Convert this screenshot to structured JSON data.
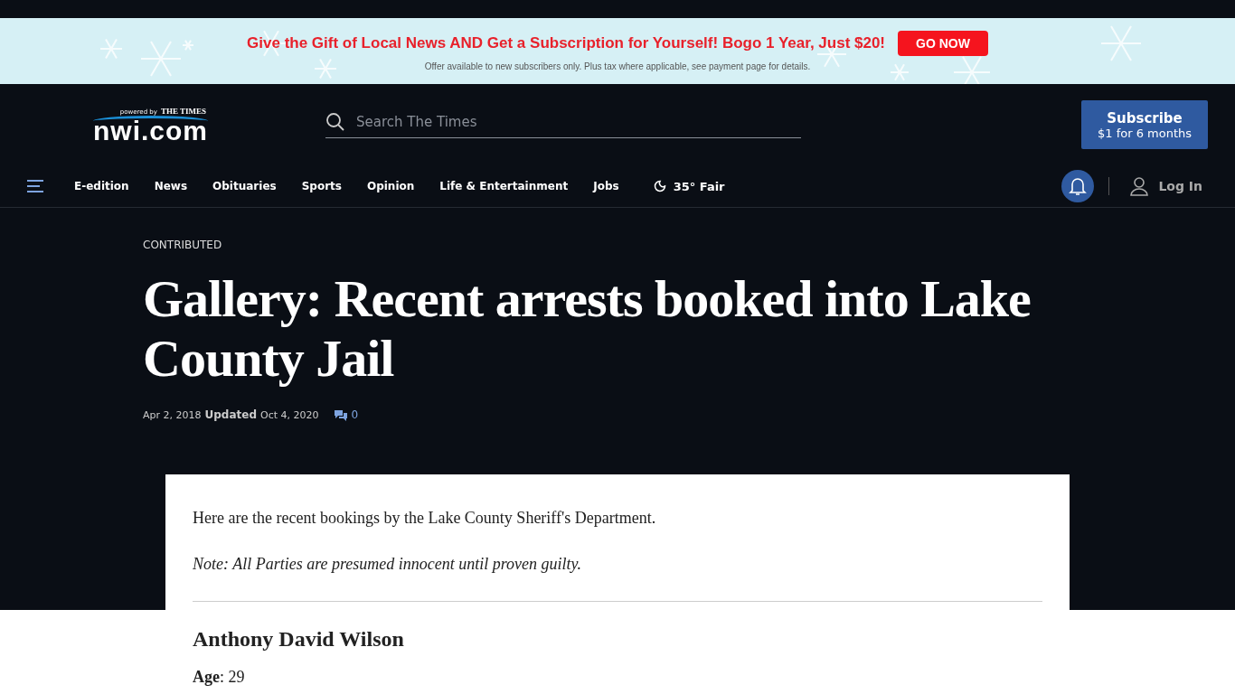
{
  "promo_banner": {
    "headline": "Give the Gift of Local News AND Get a Subscription for Yourself! Bogo 1 Year, Just $20!",
    "button": "GO NOW",
    "fine_print": "Offer available to new subscribers only. Plus tax where applicable, see payment page for details."
  },
  "header": {
    "logo": {
      "wordmark": "nwi.com",
      "tagline_small": "powered by",
      "tagline": "THE TIMES"
    },
    "search": {
      "placeholder": "Search The Times"
    },
    "subscribe": {
      "title": "Subscribe",
      "subtitle": "$1 for 6 months"
    }
  },
  "nav": {
    "items": [
      "E-edition",
      "News",
      "Obituaries",
      "Sports",
      "Opinion",
      "Life & Entertainment",
      "Jobs"
    ],
    "weather": "35° Fair",
    "login": "Log In"
  },
  "article": {
    "section": "CONTRIBUTED",
    "title": "Gallery: Recent arrests booked into Lake County Jail",
    "published": "Apr 2, 2018",
    "updated_label": "Updated",
    "updated": "Oct 4, 2020",
    "comments": "0",
    "intro": "Here are the recent bookings by the Lake County Sheriff's Department.",
    "note": "Note: All Parties are presumed innocent until proven guilty.",
    "entries": [
      {
        "name": "Anthony David Wilson",
        "age": "**Age**: 29"
      }
    ]
  }
}
